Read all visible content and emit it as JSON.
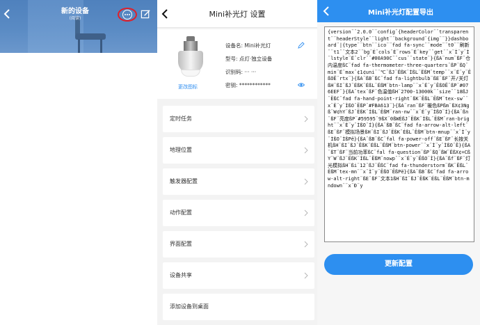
{
  "panel1": {
    "title": "新的设备",
    "subtitle": "(阅读)",
    "more_icon": "more-circle-icon",
    "edit_icon": "edit-square-icon"
  },
  "panel2": {
    "title": "Mini补光灯 设置",
    "change_icon_label": "更改图标",
    "device_name": "设备名: Mini补光灯",
    "model": "型号: 点灯·独立设备",
    "identifier": "识别码: ··· ···",
    "secret": "密钥: ************",
    "menu": [
      {
        "label": "定时任务"
      },
      {
        "label": "地理位置"
      },
      {
        "label": "触发器配置"
      },
      {
        "label": "动作配置"
      },
      {
        "label": "界面配置"
      },
      {
        "label": "设备共享"
      },
      {
        "label": "添加设备到桌面"
      }
    ]
  },
  "panel3": {
    "title": "Mini补光灯配置导出",
    "config_text": "{version¨¨2.0.0¨¨config¨{headerColor¨¨transparent¨¨headerStyle¨¨light¨¨background¨{img¨¨}}dashboard¨|{type¨¨btn¨¨ico¨¨fad fa-sync¨¨mode¨¨t0¨¨刷新¨¨t1¨¨文本2¨¨bg¨É¨cols¨É¨rows¨É¨key¨¨get¨¨x¨Ì¨y¨Ì¨lstyle¨É¨clr¨¨#00A90C¨¨cus¨¨state¨}{ßA¨num¨ßF¨仓内温度ßC¨fad fa-thermometer-three-quarters¨ßP¨ßQ¨min¨É¨max¨¢1¢uni¨¨℃¨ßJ¨ËßK¨ÍßL¨ËßM¨temp¨¨x¨É¨y¨ËßOË¨rtx¨}{ßA¨ßB¨ßC¨fad fa-lightbulb¨ßE¨ßF¨开/关灯ßH¨ßI¨ßJ¨ÉßK¨ÉßL¨ÉßM¨btn-lamp¨¨x¨É¨y¨ËßOË¨ßP¨#076EEF¨}{ßA¨tex¨ßF¨色温值ßH¨2700-13000k¨¨size¨¨18ßJ¨ËßC¨fad fa-hand-point-right¨ßK¨ËßL¨ËßM¨tex-sw¨¨x¨É¨y¨ÌßO¨ËßP¨#FBA613¨}{ßA¨ran¨ßF¨暖色ßPßm¨ßX¢3Ngß¨W¢hY¨ßJ¨ËßK¨ÍßL¨ËßM¨ran-nw¨¨x¨É¨y¨ÌßO¨Í}{ßA¨ßn¨ßF¨亮度ßP¨#59595¨9ßX¨0ßWÉßJ¨ËßK¨ÍßL¨ËßM¨ran-bright¨¨x¨É¨y¨ÌßO¨Í}{ßA¨ßB¨ßC¨fad fa-arrow-alt-left¨ßE¨ßF¨模拟场景ßH¨ßI¨ßJ¨ËßK¨ÉßL¨ËßM¨btn-mnup¨¨x¨Ì¨y¨ÌßO¨ÌßPë}{ßA¨ßB¨ßC¨fal fa-power-off¨ßE¨ßF¨长按关机ßH¨ßI¨ßJ¨ËßK¨ÉßL¨ËßM¨btn-power¨¨x¨Ì¨y¨ÌßO¨Ë}{ßA¨ßT¨ßF¨当前功率ßC¨fal fa-question¨ßP¨ßQ¨ßW¨ËßX¢=CßY¨W¨ßJ¨ËßK¨ÍßL¨ËßM¨nowp¨¨x¨É¨y¨ËßO¨Ì}{ßA¨ßf¨ßF¨灯光模拟ßH¨ßi¨12¨ßJ¨ËßC¨fad fa-thunderstorm¨ßK¨ËßL¨ËßM¨tex-mn¨¨x¨Ì¨y¨ËßO¨ËßPë}{ßA¨ßB¨ßC¨fad fa-arrow-alt-right¨ßE¨ßF¨文本1ßH¨ßI¨ßJ¨ËßK¨ÉßL¨ËßM¨btn-mndown¨¨x¨Ð¨y",
    "button_label": "更新配置"
  }
}
